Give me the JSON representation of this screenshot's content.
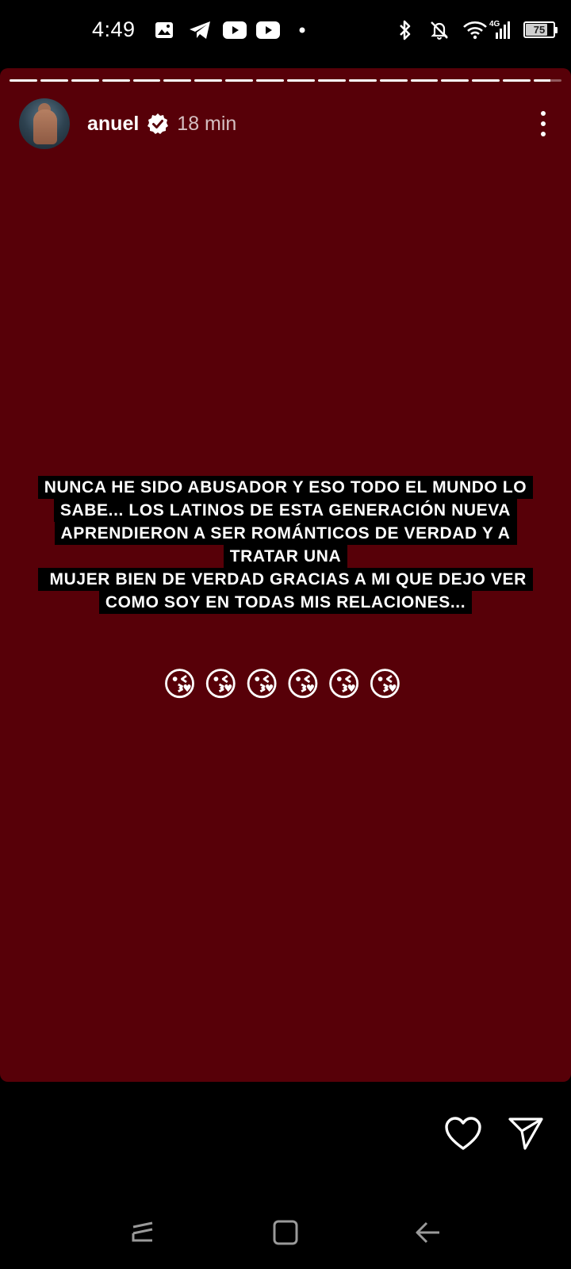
{
  "status_bar": {
    "time": "4:49",
    "network": "4G",
    "battery": "75",
    "battery_level": 0.75,
    "icons": [
      "gallery-icon",
      "telegram-icon",
      "youtube-icon",
      "youtube-icon",
      "dot-icon",
      "bluetooth-icon",
      "mute-bell-icon",
      "wifi-icon",
      "signal-icon",
      "battery-icon"
    ]
  },
  "story": {
    "username": "anuel",
    "verified": true,
    "time_ago": "18 min",
    "background_color": "#570008",
    "progress": {
      "segments": 18,
      "completed": 17,
      "current_fill": 0.6
    },
    "caption_lines": [
      "NUNCA HE SIDO ABUSADOR Y ESO TODO EL MUNDO LO",
      "SABE... LOS LATINOS DE ESTA GENERACIÓN NUEVA",
      "APRENDIERON A SER ROMÁNTICOS DE VERDAD Y A",
      "TRATAR UNA",
      " MUJER BIEN DE VERDAD GRACIAS A MI QUE DEJO VER",
      "COMO SOY EN TODAS MIS RELACIONES..."
    ],
    "emojis": "😘😘😘😘😘😘"
  },
  "actions": {
    "icons": [
      "heart-icon",
      "send-icon"
    ]
  },
  "navigation": {
    "icons": [
      "recents-icon",
      "home-icon",
      "back-icon"
    ]
  }
}
